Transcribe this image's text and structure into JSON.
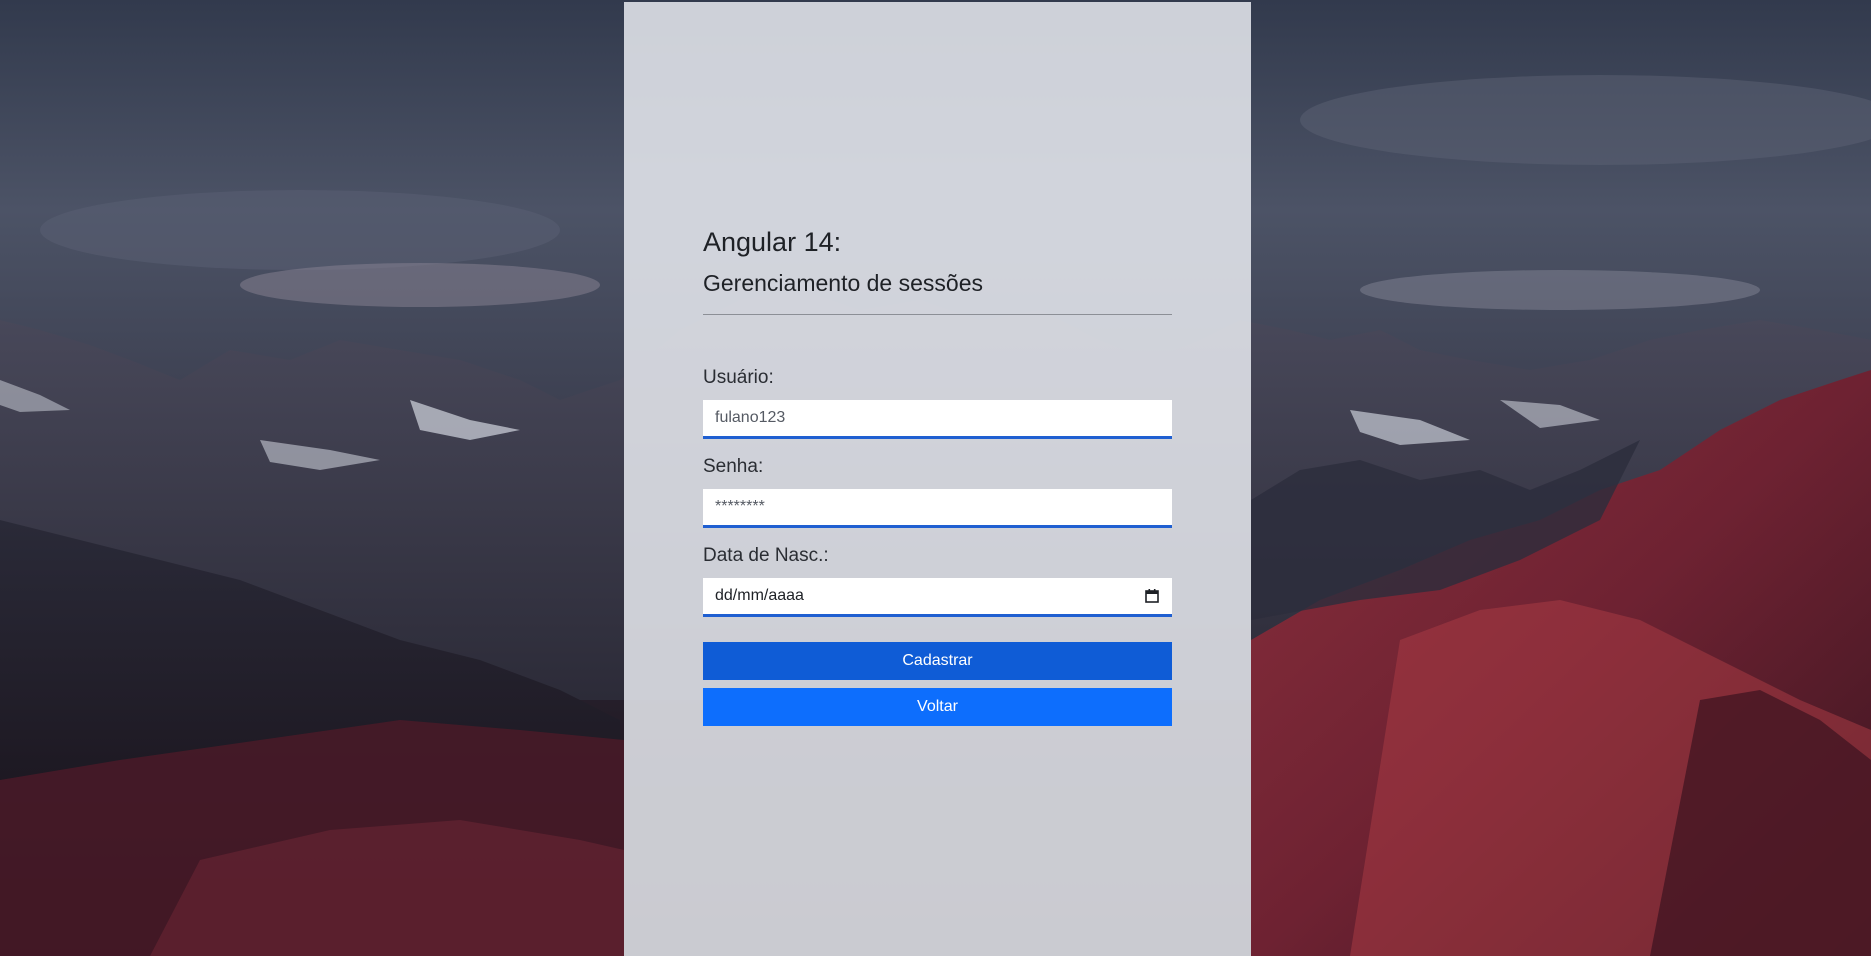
{
  "page": {
    "title": "Angular 14:",
    "subtitle": "Gerenciamento de sessões"
  },
  "form": {
    "username": {
      "label": "Usuário:",
      "value": "fulano123"
    },
    "password": {
      "label": "Senha:",
      "value": "********"
    },
    "birthdate": {
      "label": "Data de Nasc.:",
      "value": "dd/mm/aaaa",
      "icon": "calendar-icon"
    }
  },
  "buttons": {
    "register_label": "Cadastrar",
    "back_label": "Voltar"
  },
  "colors": {
    "register_button": "#0f5cd6",
    "back_button": "#0d6efd",
    "input_underline": "#1f5fd1",
    "panel": "#e8eaf0"
  }
}
